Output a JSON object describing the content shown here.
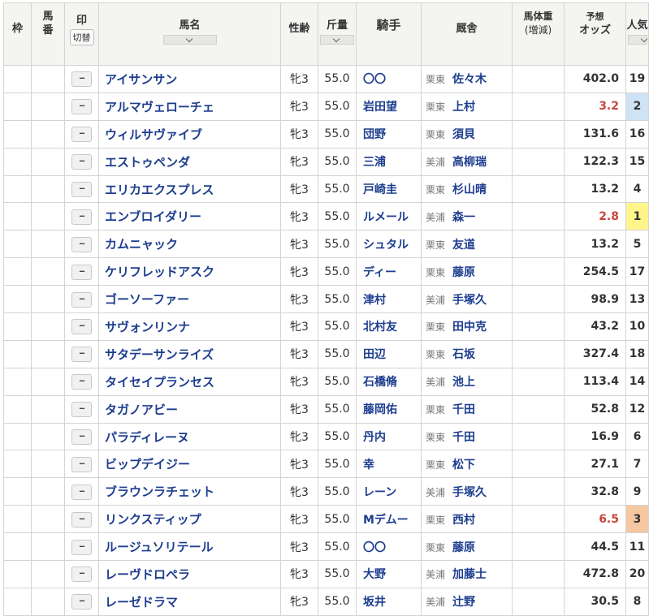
{
  "headers": {
    "waku": "枠",
    "umaban_line1": "馬",
    "umaban_line2": "番",
    "mark": "印",
    "mark_switch": "切替",
    "horse_name": "馬名",
    "sex_age": "性齢",
    "weight": "斤量",
    "jockey": "騎手",
    "stable": "厩舎",
    "body_weight_line1": "馬体重",
    "body_weight_line2": "(増減)",
    "odds_line1": "予想",
    "odds_line2": "オッズ",
    "popularity_line1": "人気"
  },
  "mark_placeholder": "--",
  "highlight_colors": {
    "pop1": "#fff58a",
    "pop2": "#cfe3f6",
    "pop3": "#f5c8a1",
    "hot_odds": "#c8463d",
    "name_link": "#1d3d8f"
  },
  "rows": [
    {
      "waku": "",
      "umaban": "",
      "horse": "アイサンサン",
      "sex_age": "牝3",
      "weight": "55.0",
      "jockey": "〇〇",
      "region": "栗東",
      "trainer": "佐々木",
      "body_weight": "",
      "odds": "402.0",
      "pop": "19"
    },
    {
      "waku": "",
      "umaban": "",
      "horse": "アルマヴェローチェ",
      "sex_age": "牝3",
      "weight": "55.0",
      "jockey": "岩田望",
      "region": "栗東",
      "trainer": "上村",
      "body_weight": "",
      "odds": "3.2",
      "pop": "2"
    },
    {
      "waku": "",
      "umaban": "",
      "horse": "ウィルサヴァイブ",
      "sex_age": "牝3",
      "weight": "55.0",
      "jockey": "団野",
      "region": "栗東",
      "trainer": "須貝",
      "body_weight": "",
      "odds": "131.6",
      "pop": "16"
    },
    {
      "waku": "",
      "umaban": "",
      "horse": "エストゥペンダ",
      "sex_age": "牝3",
      "weight": "55.0",
      "jockey": "三浦",
      "region": "美浦",
      "trainer": "高柳瑞",
      "body_weight": "",
      "odds": "122.3",
      "pop": "15"
    },
    {
      "waku": "",
      "umaban": "",
      "horse": "エリカエクスプレス",
      "sex_age": "牝3",
      "weight": "55.0",
      "jockey": "戸崎圭",
      "region": "栗東",
      "trainer": "杉山晴",
      "body_weight": "",
      "odds": "13.2",
      "pop": "4"
    },
    {
      "waku": "",
      "umaban": "",
      "horse": "エンブロイダリー",
      "sex_age": "牝3",
      "weight": "55.0",
      "jockey": "ルメール",
      "region": "美浦",
      "trainer": "森一",
      "body_weight": "",
      "odds": "2.8",
      "pop": "1"
    },
    {
      "waku": "",
      "umaban": "",
      "horse": "カムニャック",
      "sex_age": "牝3",
      "weight": "55.0",
      "jockey": "シュタル",
      "region": "栗東",
      "trainer": "友道",
      "body_weight": "",
      "odds": "13.2",
      "pop": "5"
    },
    {
      "waku": "",
      "umaban": "",
      "horse": "ケリフレッドアスク",
      "sex_age": "牝3",
      "weight": "55.0",
      "jockey": "ディー",
      "region": "栗東",
      "trainer": "藤原",
      "body_weight": "",
      "odds": "254.5",
      "pop": "17"
    },
    {
      "waku": "",
      "umaban": "",
      "horse": "ゴーソーファー",
      "sex_age": "牝3",
      "weight": "55.0",
      "jockey": "津村",
      "region": "美浦",
      "trainer": "手塚久",
      "body_weight": "",
      "odds": "98.9",
      "pop": "13"
    },
    {
      "waku": "",
      "umaban": "",
      "horse": "サヴォンリンナ",
      "sex_age": "牝3",
      "weight": "55.0",
      "jockey": "北村友",
      "region": "栗東",
      "trainer": "田中克",
      "body_weight": "",
      "odds": "43.2",
      "pop": "10"
    },
    {
      "waku": "",
      "umaban": "",
      "horse": "サタデーサンライズ",
      "sex_age": "牝3",
      "weight": "55.0",
      "jockey": "田辺",
      "region": "栗東",
      "trainer": "石坂",
      "body_weight": "",
      "odds": "327.4",
      "pop": "18"
    },
    {
      "waku": "",
      "umaban": "",
      "horse": "タイセイプランセス",
      "sex_age": "牝3",
      "weight": "55.0",
      "jockey": "石橋脩",
      "region": "美浦",
      "trainer": "池上",
      "body_weight": "",
      "odds": "113.4",
      "pop": "14"
    },
    {
      "waku": "",
      "umaban": "",
      "horse": "タガノアビー",
      "sex_age": "牝3",
      "weight": "55.0",
      "jockey": "藤岡佑",
      "region": "栗東",
      "trainer": "千田",
      "body_weight": "",
      "odds": "52.8",
      "pop": "12"
    },
    {
      "waku": "",
      "umaban": "",
      "horse": "パラディレーヌ",
      "sex_age": "牝3",
      "weight": "55.0",
      "jockey": "丹内",
      "region": "栗東",
      "trainer": "千田",
      "body_weight": "",
      "odds": "16.9",
      "pop": "6"
    },
    {
      "waku": "",
      "umaban": "",
      "horse": "ビップデイジー",
      "sex_age": "牝3",
      "weight": "55.0",
      "jockey": "幸",
      "region": "栗東",
      "trainer": "松下",
      "body_weight": "",
      "odds": "27.1",
      "pop": "7"
    },
    {
      "waku": "",
      "umaban": "",
      "horse": "ブラウンラチェット",
      "sex_age": "牝3",
      "weight": "55.0",
      "jockey": "レーン",
      "region": "美浦",
      "trainer": "手塚久",
      "body_weight": "",
      "odds": "32.8",
      "pop": "9"
    },
    {
      "waku": "",
      "umaban": "",
      "horse": "リンクスティップ",
      "sex_age": "牝3",
      "weight": "55.0",
      "jockey": "Mデムー",
      "region": "栗東",
      "trainer": "西村",
      "body_weight": "",
      "odds": "6.5",
      "pop": "3"
    },
    {
      "waku": "",
      "umaban": "",
      "horse": "ルージュソリテール",
      "sex_age": "牝3",
      "weight": "55.0",
      "jockey": "〇〇",
      "region": "栗東",
      "trainer": "藤原",
      "body_weight": "",
      "odds": "44.5",
      "pop": "11"
    },
    {
      "waku": "",
      "umaban": "",
      "horse": "レーヴドロペラ",
      "sex_age": "牝3",
      "weight": "55.0",
      "jockey": "大野",
      "region": "美浦",
      "trainer": "加藤士",
      "body_weight": "",
      "odds": "472.8",
      "pop": "20"
    },
    {
      "waku": "",
      "umaban": "",
      "horse": "レーゼドラマ",
      "sex_age": "牝3",
      "weight": "55.0",
      "jockey": "坂井",
      "region": "美浦",
      "trainer": "辻野",
      "body_weight": "",
      "odds": "30.5",
      "pop": "8"
    }
  ]
}
